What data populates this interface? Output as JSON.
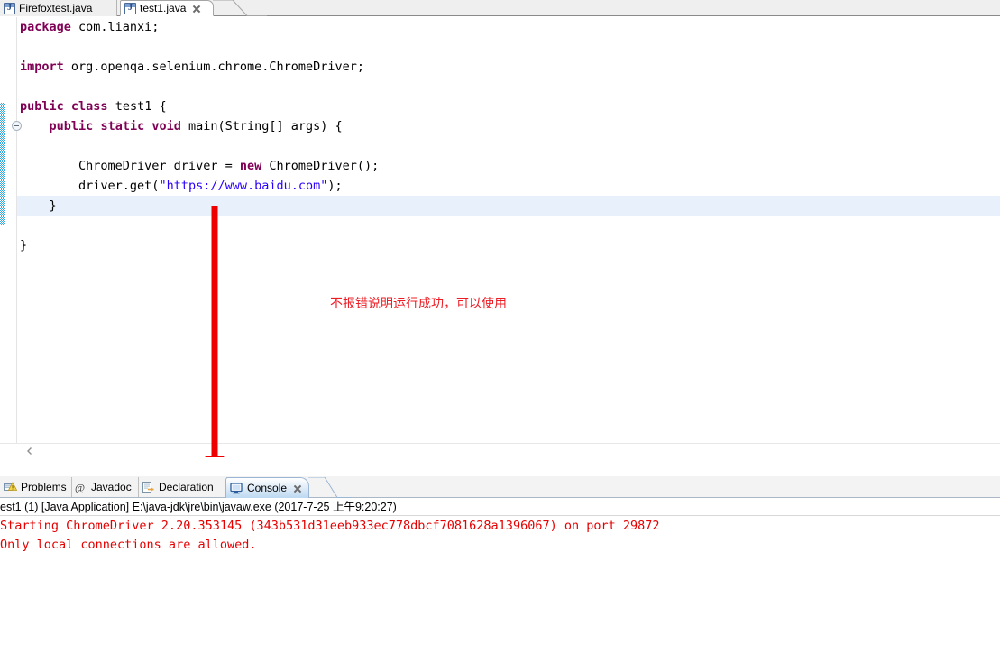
{
  "editor": {
    "tabs": [
      {
        "label": "Firefoxtest.java",
        "icon": "java-file-icon",
        "active": false,
        "closable": false
      },
      {
        "label": "test1.java",
        "icon": "java-file-icon",
        "active": true,
        "closable": true
      }
    ],
    "code_lines": [
      [
        {
          "t": "package",
          "c": "kw"
        },
        {
          "t": " com.lianxi;",
          "c": "plain"
        }
      ],
      [],
      [
        {
          "t": "import",
          "c": "kw"
        },
        {
          "t": " org.openqa.selenium.chrome.ChromeDriver;",
          "c": "plain"
        }
      ],
      [],
      [
        {
          "t": "public",
          "c": "kw"
        },
        {
          "t": " ",
          "c": "plain"
        },
        {
          "t": "class",
          "c": "kw"
        },
        {
          "t": " test1 {",
          "c": "plain"
        }
      ],
      [
        {
          "t": "    ",
          "c": "plain"
        },
        {
          "t": "public",
          "c": "kw"
        },
        {
          "t": " ",
          "c": "plain"
        },
        {
          "t": "static",
          "c": "kw"
        },
        {
          "t": " ",
          "c": "plain"
        },
        {
          "t": "void",
          "c": "kw"
        },
        {
          "t": " main(String[] args) {",
          "c": "plain"
        }
      ],
      [],
      [
        {
          "t": "        ChromeDriver driver = ",
          "c": "plain"
        },
        {
          "t": "new",
          "c": "kw"
        },
        {
          "t": " ChromeDriver();",
          "c": "plain"
        }
      ],
      [
        {
          "t": "        driver.get(",
          "c": "plain"
        },
        {
          "t": "\"https://www.baidu.com\"",
          "c": "str"
        },
        {
          "t": ");",
          "c": "plain"
        }
      ],
      [
        {
          "t": "    }",
          "c": "plain"
        }
      ],
      [],
      [
        {
          "t": "}",
          "c": "plain"
        }
      ]
    ],
    "colors": {
      "keyword": "#7F0055",
      "string": "#2A00FF",
      "plain": "#000000",
      "current_line_highlight": "#E8F0FB",
      "change_bar": "#39A8DC"
    }
  },
  "annotation": {
    "text": "不报错说明运行成功，可以使用",
    "color": "#ED1C24",
    "arrow": "down-arrow"
  },
  "bottom_panel": {
    "tabs": [
      {
        "label": "Problems",
        "icon": "problems-icon",
        "active": false,
        "closable": false
      },
      {
        "label": "Javadoc",
        "icon": "javadoc-at-icon",
        "active": false,
        "closable": false
      },
      {
        "label": "Declaration",
        "icon": "declaration-icon",
        "active": false,
        "closable": false
      },
      {
        "label": "Console",
        "icon": "console-icon",
        "active": true,
        "closable": true
      }
    ],
    "console": {
      "launch_line": "est1 (1) [Java Application] E:\\java-jdk\\jre\\bin\\javaw.exe (2017-7-25 上午9:20:27)",
      "output_lines": [
        "Starting ChromeDriver 2.20.353145 (343b531d31eeb933ec778dbcf7081628a1396067) on port 29872",
        "Only local connections are allowed."
      ],
      "output_color": "#E60000"
    }
  }
}
